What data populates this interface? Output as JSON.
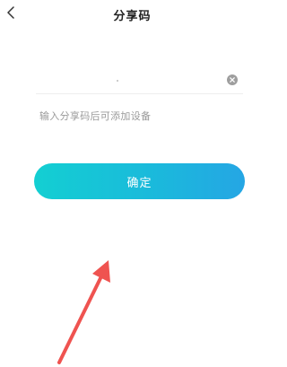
{
  "header": {
    "back_icon": "chevron-left-icon",
    "title": "分享码"
  },
  "share_code_input": {
    "value": "",
    "clear_icon": "clear-circle-icon"
  },
  "hint": "输入分享码后可添加设备",
  "confirm_label": "确定",
  "colors": {
    "accent_start": "#13cfd2",
    "accent_end": "#25a6e4",
    "annotation_arrow": "#ef5350"
  }
}
